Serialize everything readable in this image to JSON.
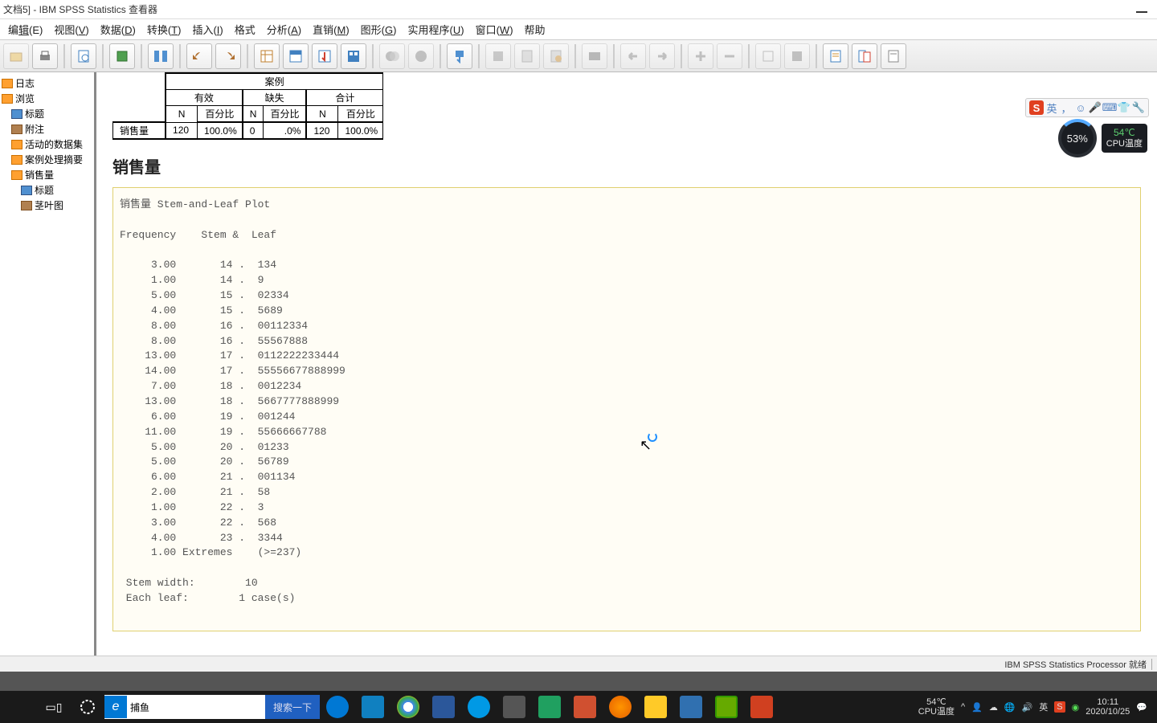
{
  "title": "文档5] - IBM SPSS Statistics 查看器",
  "menu": {
    "edit": "编辑(E)",
    "view": "视图(V)",
    "data": "数据(D)",
    "transform": "转换(T)",
    "insert": "插入(I)",
    "format": "格式",
    "analyze": "分析(A)",
    "direct": "直销(M)",
    "graph": "图形(G)",
    "util": "实用程序(U)",
    "window": "窗口(W)",
    "help": "帮助"
  },
  "outline": {
    "log": "日志",
    "browse": "浏览",
    "title": "标题",
    "note": "附注",
    "active": "活动的数据集",
    "casesummary": "案例处理摘要",
    "sales": "销售量",
    "subtitle": "标题",
    "stemleaf": "茎叶图"
  },
  "table": {
    "header_top": "案例",
    "valid": "有效",
    "missing": "缺失",
    "total": "合计",
    "N": "N",
    "pct": "百分比",
    "rowlabel": "销售量",
    "v_n": "120",
    "v_pct": "100.0%",
    "m_n": "0",
    "m_pct": ".0%",
    "t_n": "120",
    "t_pct": "100.0%"
  },
  "section_title": "销售量",
  "stemleaf": "销售量 Stem-and-Leaf Plot\n\nFrequency    Stem &  Leaf\n\n     3.00       14 .  134\n     1.00       14 .  9\n     5.00       15 .  02334\n     4.00       15 .  5689\n     8.00       16 .  00112334\n     8.00       16 .  55567888\n    13.00       17 .  0112222233444\n    14.00       17 .  55556677888999\n     7.00       18 .  0012234\n    13.00       18 .  5667777888999\n     6.00       19 .  001244\n    11.00       19 .  55666667788\n     5.00       20 .  01233\n     5.00       20 .  56789\n     6.00       21 .  001134\n     2.00       21 .  58\n     1.00       22 .  3\n     3.00       22 .  568\n     4.00       23 .  3344\n     1.00 Extremes    (>=237)\n\n Stem width:        10\n Each leaf:        1 case(s)",
  "status": "IBM SPSS Statistics Processor 就绪",
  "float": {
    "lang": "英",
    "pct": "53%",
    "temp": "54℃",
    "cpu": "CPU温度"
  },
  "taskbar": {
    "search_placeholder": "捕鱼",
    "search_btn": "搜索一下",
    "tray_temp": "54℃",
    "tray_cpu": "CPU温度",
    "tray_lang": "英",
    "time": "10:11",
    "date": "2020/10/25"
  }
}
